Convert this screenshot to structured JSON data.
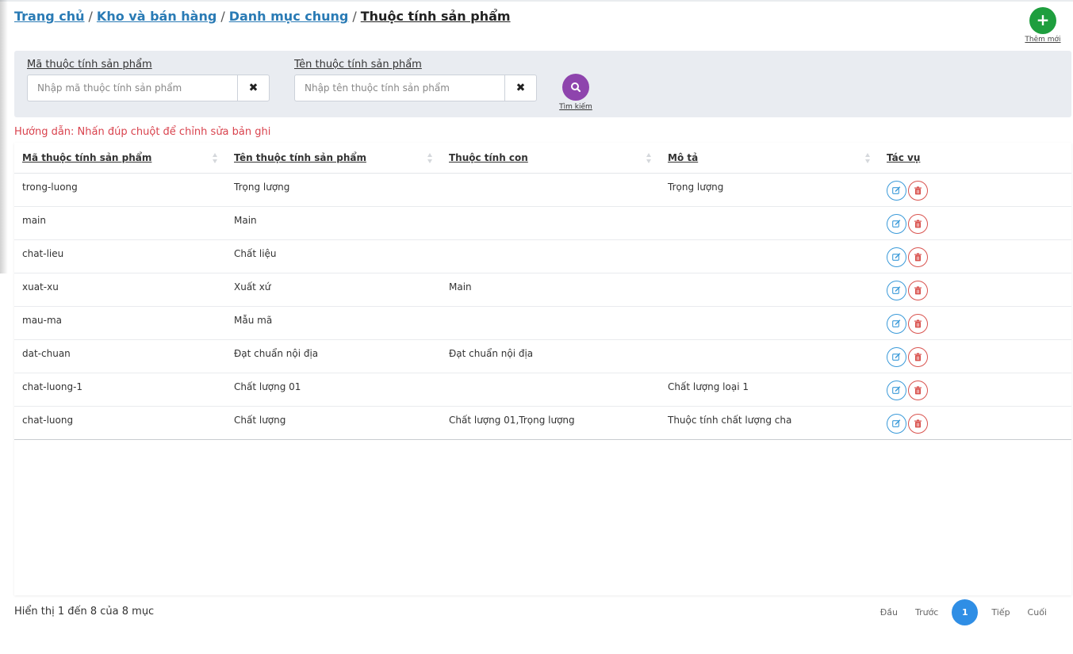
{
  "breadcrumb": {
    "home": "Trang chủ",
    "warehouse": "Kho và bán hàng",
    "catalog": "Danh mục chung",
    "current": "Thuộc tính sản phẩm",
    "separator": "/"
  },
  "add_button": {
    "label": "Thêm mới",
    "icon": "plus-icon",
    "color": "#1e9e3e"
  },
  "filters": {
    "code": {
      "label": "Mã thuộc tính sản phẩm",
      "placeholder": "Nhập mã thuộc tính sản phẩm",
      "value": ""
    },
    "name": {
      "label": "Tên thuộc tính sản phẩm",
      "placeholder": "Nhập tên thuộc tính sản phẩm",
      "value": ""
    },
    "search_label": "Tìm kiếm",
    "search_color": "#8e44ad"
  },
  "hint": "Hướng dẫn: Nhấn đúp chuột để chỉnh sửa bản ghi",
  "table": {
    "columns": [
      "Mã thuộc tính sản phẩm",
      "Tên thuộc tính sản phẩm",
      "Thuộc tính con",
      "Mô tả",
      "Tác vụ"
    ],
    "rows": [
      [
        "trong-luong",
        "Trọng lượng",
        "",
        "Trọng lượng"
      ],
      [
        "main",
        "Main",
        "",
        ""
      ],
      [
        "chat-lieu",
        "Chất liệu",
        "",
        ""
      ],
      [
        "xuat-xu",
        "Xuất xứ",
        "Main",
        ""
      ],
      [
        "mau-ma",
        "Mẫu mã",
        "",
        ""
      ],
      [
        "dat-chuan",
        "Đạt chuẩn nội địa",
        "Đạt chuẩn nội địa",
        ""
      ],
      [
        "chat-luong-1",
        "Chất lượng 01",
        "",
        "Chất lượng loại 1"
      ],
      [
        "chat-luong",
        "Chất lượng",
        "Chất lượng 01,Trọng lượng",
        "Thuộc tính chất lượng cha"
      ]
    ]
  },
  "footer": {
    "info": "Hiển thị 1 đến 8 của 8 mục",
    "pager": {
      "first": "Đầu",
      "prev": "Trước",
      "current": "1",
      "next": "Tiếp",
      "last": "Cuối"
    },
    "accent": "#2f8ee5"
  }
}
